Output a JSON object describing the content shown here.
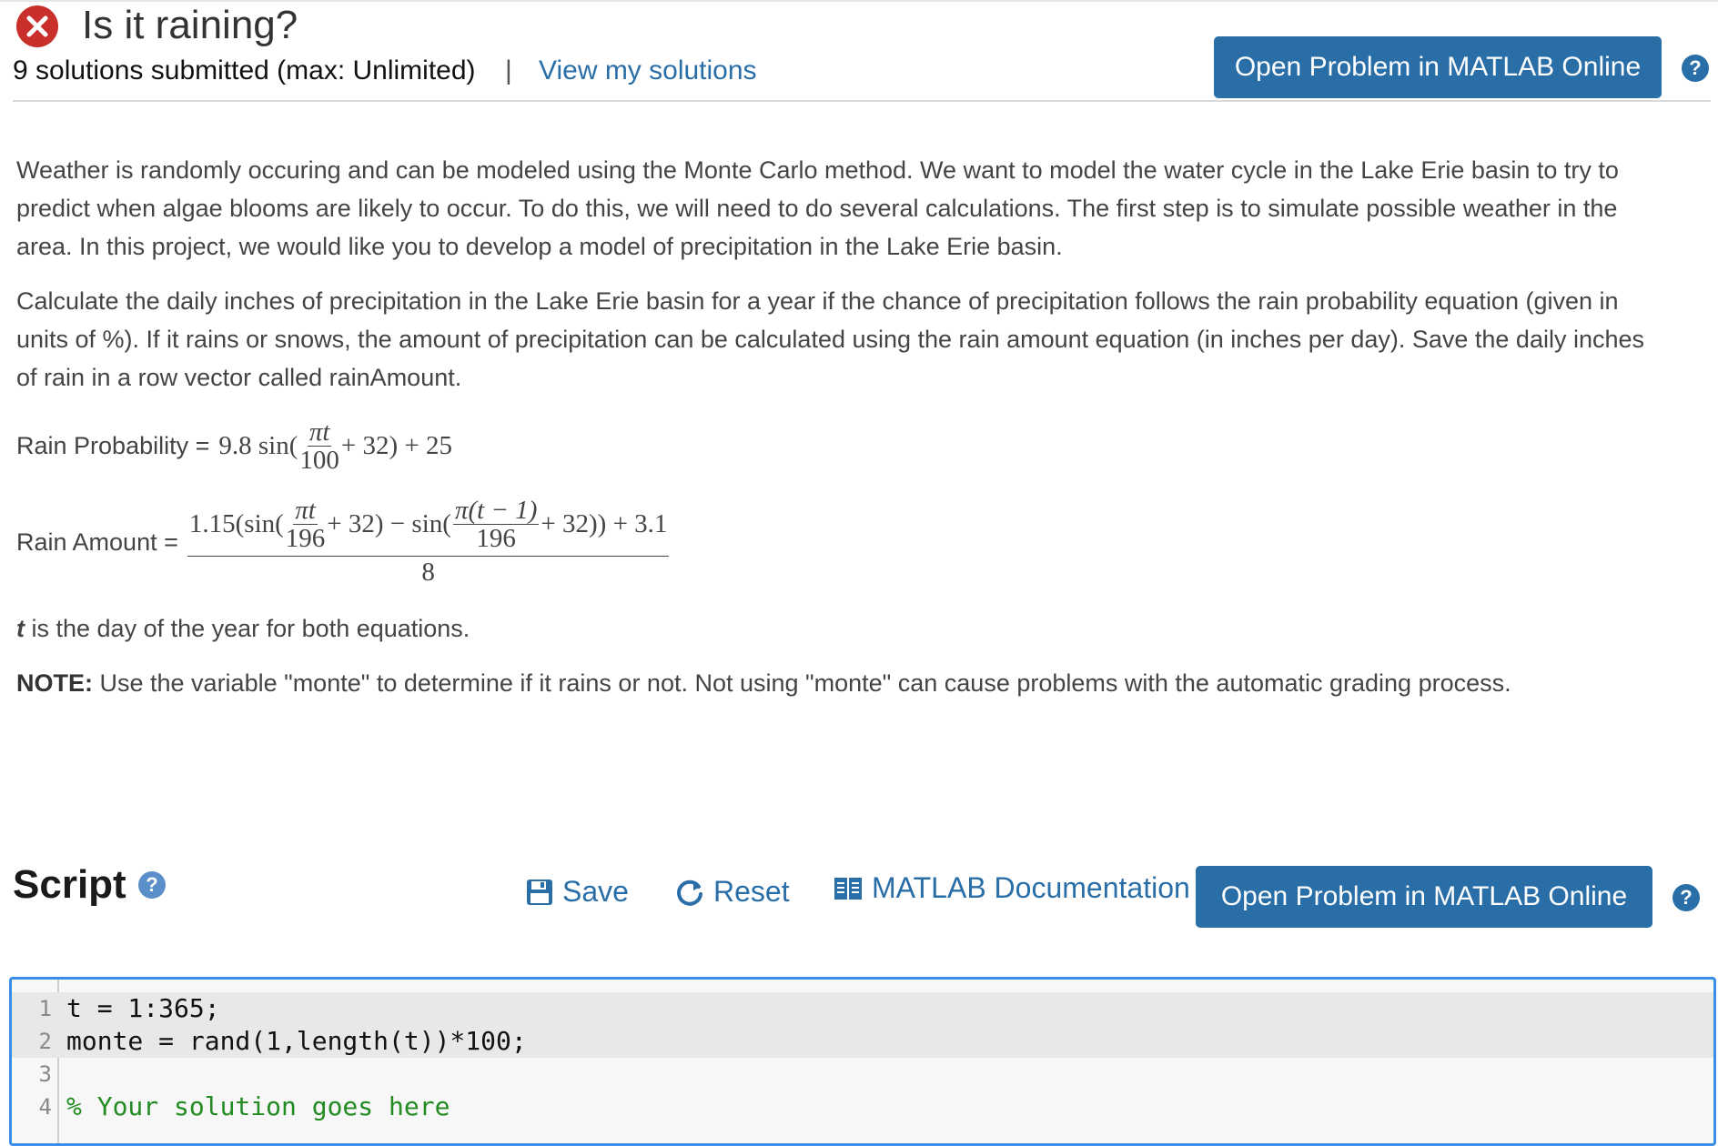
{
  "problem": {
    "title": "Is it raining?",
    "solutions_summary": "9 solutions submitted (max: Unlimited)",
    "separator": "|",
    "view_solutions_link": "View my solutions",
    "open_button": "Open Problem in MATLAB Online",
    "help_glyph": "?",
    "status_icon": "error-x-icon",
    "status_color": "#c9302c"
  },
  "description": {
    "para1": "Weather is randomly occuring and can be modeled using the Monte Carlo method. We want to model the water cycle in the Lake Erie basin to try to predict when algae blooms are likely to occur. To do this, we will need to do several calculations. The first step is to simulate possible weather in the area. In this project, we would like you to develop a model of precipitation in the Lake Erie basin.",
    "para2": "Calculate the daily inches of precipitation in the Lake Erie basin for a year if the chance of precipitation follows the rain probability equation (given in units of %). If it rains or snows, the amount of precipitation can be calculated using the rain amount equation (in inches per day). Save the daily inches of rain in a row vector called rainAmount.",
    "eq1_label": "Rain Probability =",
    "eq1_pre": "9.8 sin(",
    "eq1_num": "πt",
    "eq1_den": "100",
    "eq1_post": "+ 32) + 25",
    "eq2_label": "Rain Amount =",
    "eq2_a": "1.15(sin(",
    "eq2_f1_num": "πt",
    "eq2_f1_den": "196",
    "eq2_b": "+ 32) − sin(",
    "eq2_f2_num": "π(t − 1)",
    "eq2_f2_den": "196",
    "eq2_c": "+ 32)) + 3.1",
    "eq2_denominator": "8",
    "t_var": "t",
    "t_note": " is the day of the year for both equations.",
    "note_label": "NOTE:",
    "note_text": " Use the variable \"monte\" to determine if it rains or not. Not using \"monte\" can cause problems with the automatic grading process."
  },
  "script": {
    "title": "Script",
    "help_glyph": "?",
    "save_label": "Save",
    "save_icon": "floppy-disk-icon",
    "reset_label": "Reset",
    "reset_icon": "refresh-icon",
    "docs_label": "MATLAB Documentation",
    "docs_icon": "book-icon",
    "open_button": "Open Problem in MATLAB Online"
  },
  "code": {
    "lines": [
      {
        "n": "1",
        "text": "t = 1:365;"
      },
      {
        "n": "2",
        "text": "monte = rand(1,length(t))*100;"
      },
      {
        "n": "3",
        "text": ""
      },
      {
        "n": "4",
        "text": "% Your solution goes here"
      }
    ]
  }
}
